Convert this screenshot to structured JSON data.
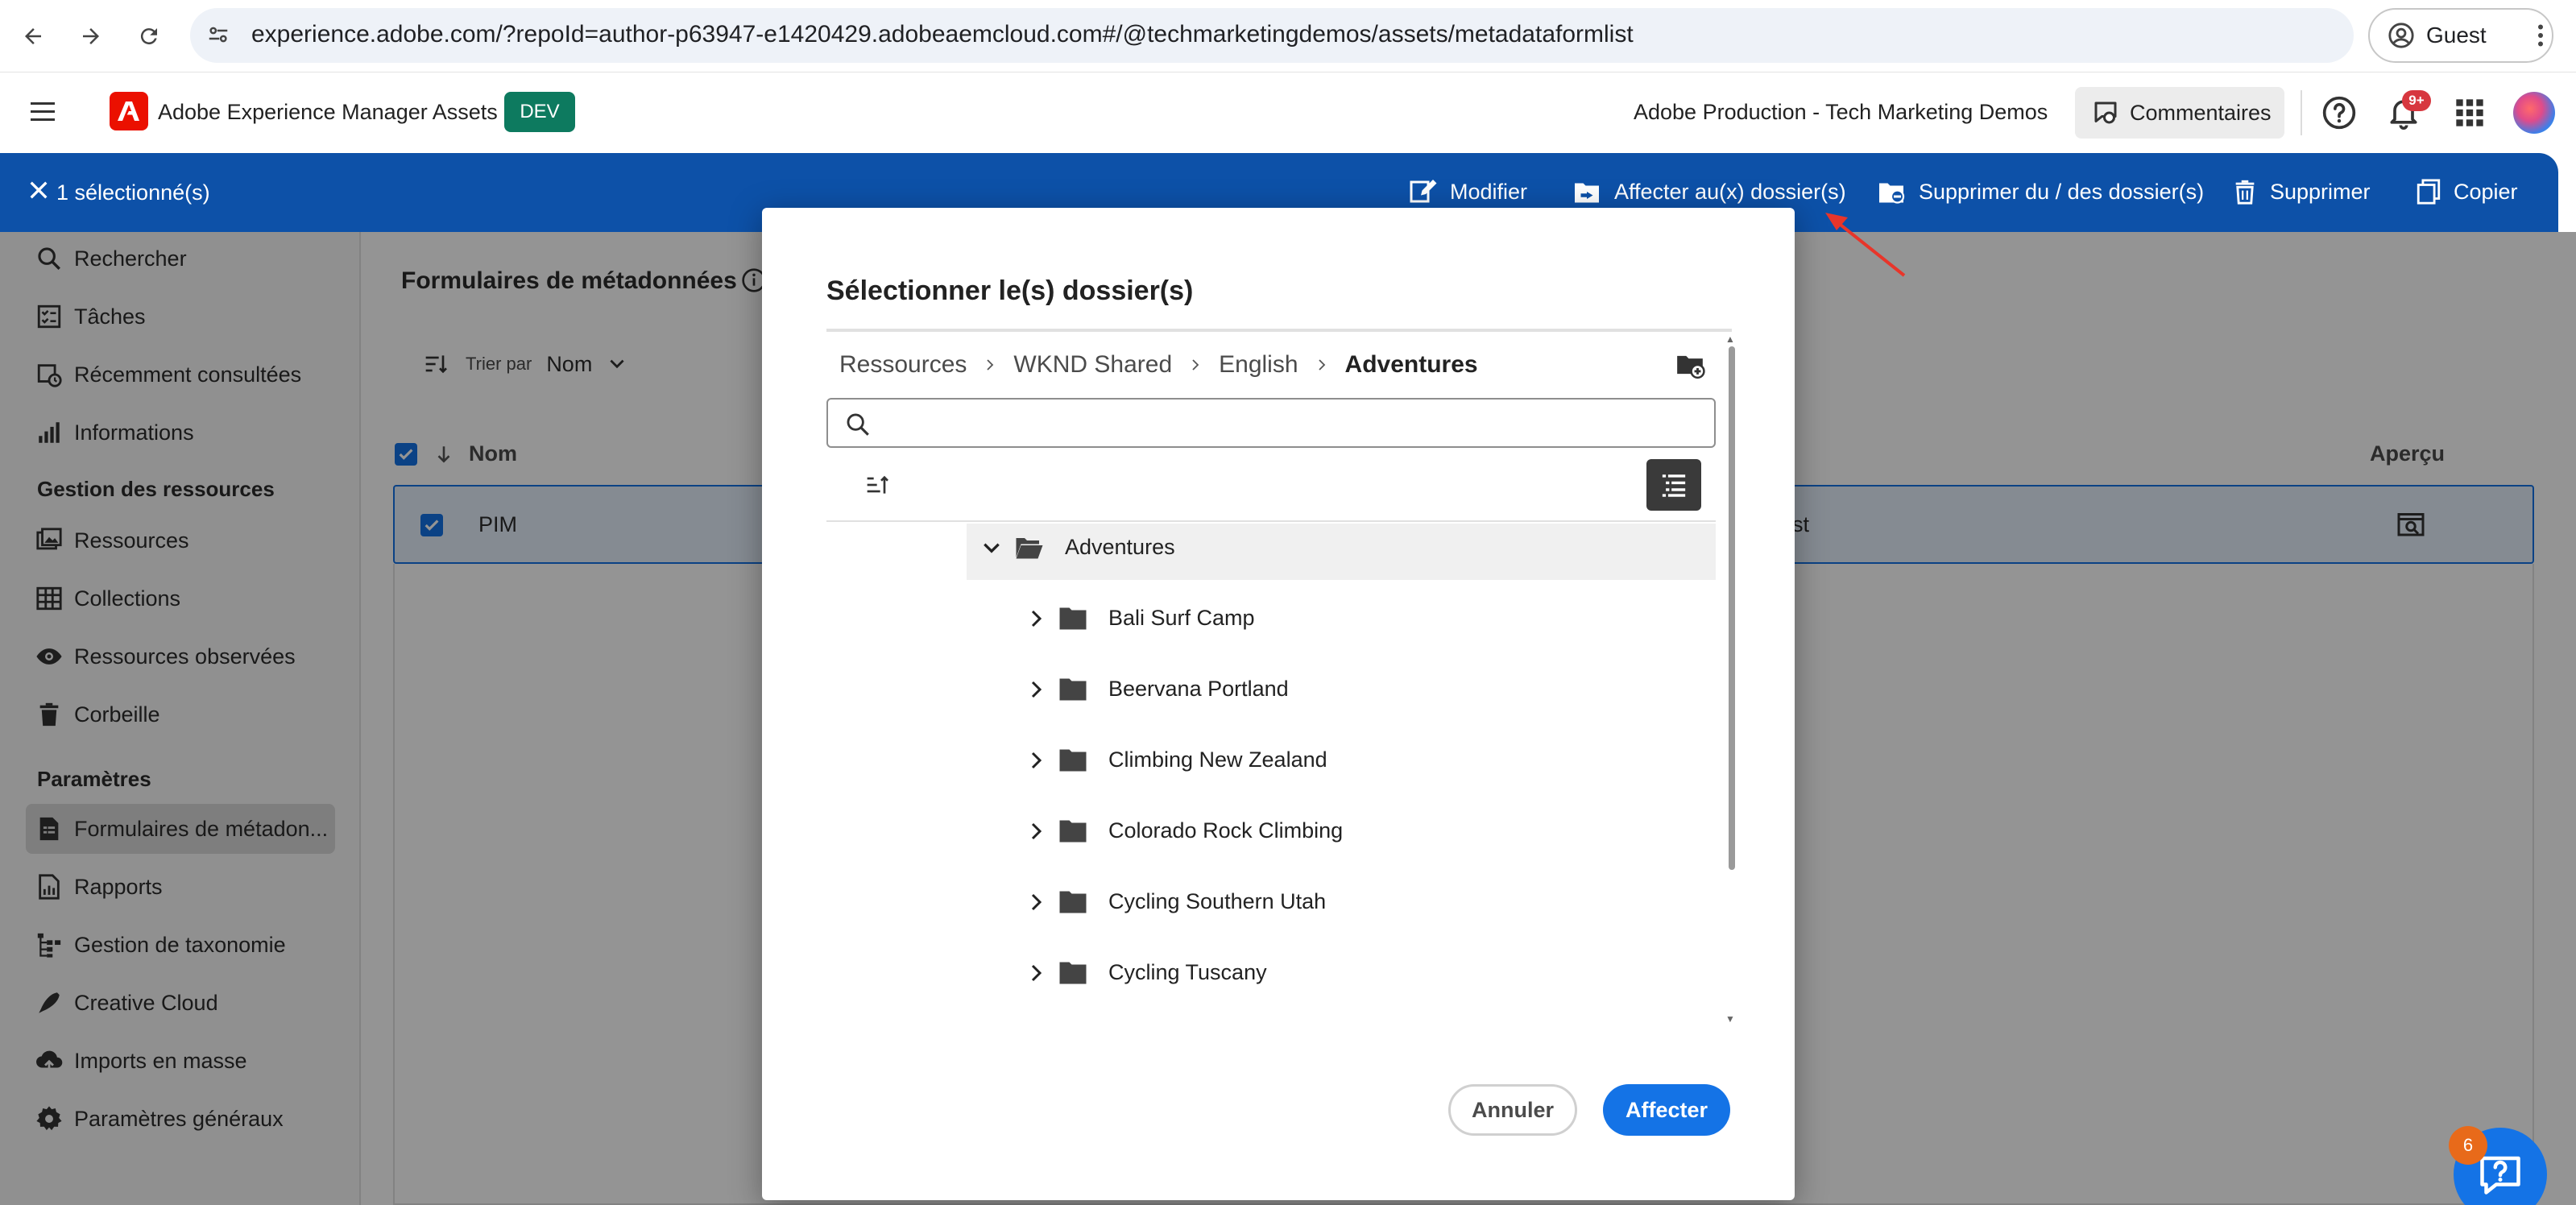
{
  "browser": {
    "url": "experience.adobe.com/?repoId=author-p63947-e1420429.adobeaemcloud.com#/@techmarketingdemos/assets/metadataformlist",
    "profile_label": "Guest"
  },
  "header": {
    "app_name": "Adobe Experience Manager Assets",
    "env_badge": "DEV",
    "org_name": "Adobe Production - Tech Marketing Demos",
    "comments_label": "Commentaires",
    "notifications_badge": "9+"
  },
  "action_bar": {
    "selection_label": "1 sélectionné(s)",
    "actions": [
      {
        "label": "Modifier",
        "icon": "edit-icon"
      },
      {
        "label": "Affecter au(x) dossier(s)",
        "icon": "assign-folder-icon"
      },
      {
        "label": "Supprimer du / des dossier(s)",
        "icon": "remove-folder-icon"
      },
      {
        "label": "Supprimer",
        "icon": "trash-icon"
      },
      {
        "label": "Copier",
        "icon": "copy-icon"
      }
    ]
  },
  "sidebar": {
    "items_top": [
      {
        "label": "Rechercher",
        "icon": "search-icon"
      },
      {
        "label": "Tâches",
        "icon": "tasks-icon"
      },
      {
        "label": "Récemment consultées",
        "icon": "recent-icon"
      },
      {
        "label": "Informations",
        "icon": "chart-icon"
      }
    ],
    "section_assets": "Gestion des ressources",
    "items_assets": [
      {
        "label": "Ressources",
        "icon": "assets-icon"
      },
      {
        "label": "Collections",
        "icon": "collections-icon"
      },
      {
        "label": "Ressources observées",
        "icon": "eye-icon"
      },
      {
        "label": "Corbeille",
        "icon": "trash-icon"
      }
    ],
    "section_settings": "Paramètres",
    "items_settings": [
      {
        "label": "Formulaires de métadon...",
        "icon": "form-icon"
      },
      {
        "label": "Rapports",
        "icon": "reports-icon"
      },
      {
        "label": "Gestion de taxonomie",
        "icon": "taxonomy-icon"
      },
      {
        "label": "Creative Cloud",
        "icon": "creative-cloud-icon"
      },
      {
        "label": "Imports en masse",
        "icon": "upload-cloud-icon"
      },
      {
        "label": "Paramètres généraux",
        "icon": "gear-icon"
      }
    ]
  },
  "main": {
    "title": "Formulaires de métadonnées",
    "sort_label": "Trier par",
    "sort_value": "Nom",
    "columns": {
      "name": "Nom",
      "preview": "Aperçu"
    },
    "row": {
      "name": "PIM",
      "partial_text": "ast"
    }
  },
  "dialog": {
    "title": "Sélectionner le(s) dossier(s)",
    "breadcrumb": [
      "Ressources",
      "WKND Shared",
      "English",
      "Adventures"
    ],
    "search_placeholder": "",
    "tree_root": "Adventures",
    "folders": [
      "Bali Surf Camp",
      "Beervana Portland",
      "Climbing New Zealand",
      "Colorado Rock Climbing",
      "Cycling Southern Utah",
      "Cycling Tuscany"
    ],
    "cancel_label": "Annuler",
    "assign_label": "Affecter"
  },
  "help_widget": {
    "count": "6"
  },
  "colors": {
    "action_bar": "#0d51a8",
    "accent": "#1473e6",
    "dev_badge": "#0d7a5f",
    "adobe_red": "#eb1000"
  }
}
